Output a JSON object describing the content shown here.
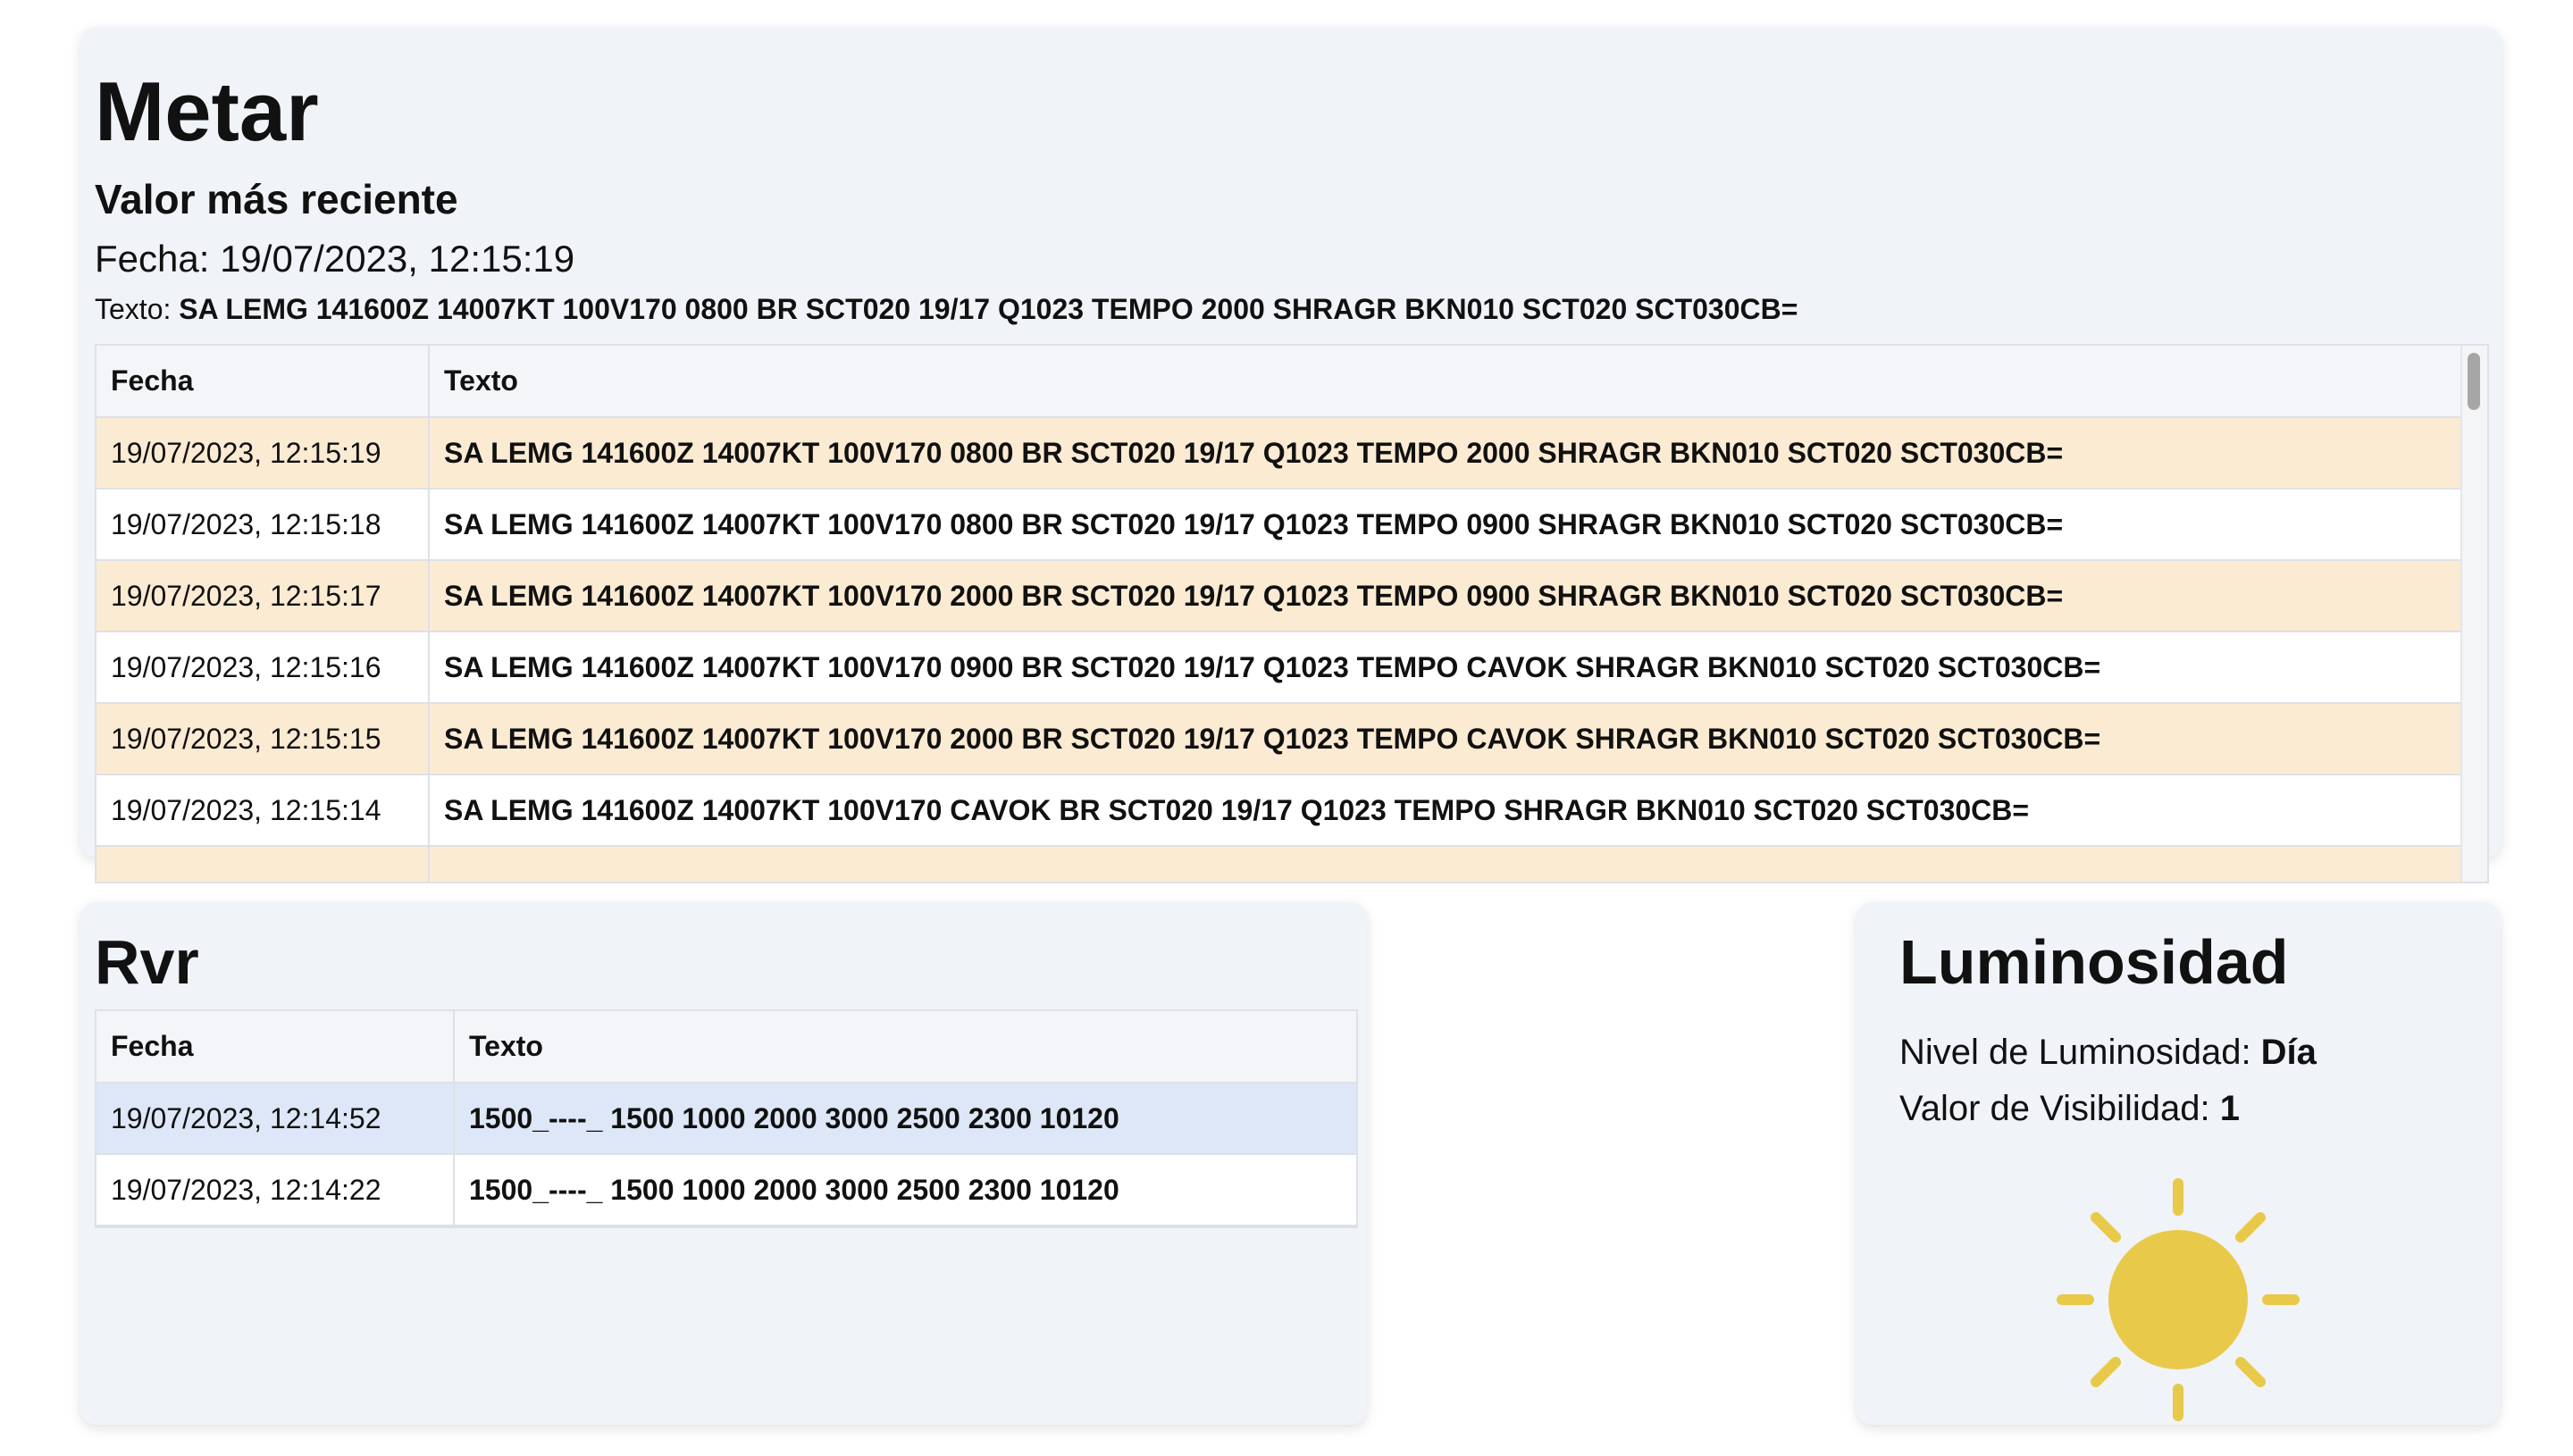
{
  "metar": {
    "title": "Metar",
    "subtitle": "Valor más reciente",
    "fecha_label": "Fecha: ",
    "fecha_value": "19/07/2023, 12:15:19",
    "texto_label": "Texto: ",
    "texto_value": "SA LEMG 141600Z 14007KT 100V170 0800 BR SCT020 19/17 Q1023 TEMPO 2000 SHRAGR BKN010 SCT020 SCT030CB=",
    "columns": [
      "Fecha",
      "Texto"
    ],
    "rows": [
      {
        "fecha": "19/07/2023, 12:15:19",
        "texto": "SA LEMG 141600Z 14007KT 100V170 0800 BR SCT020 19/17 Q1023 TEMPO 2000 SHRAGR BKN010 SCT020 SCT030CB="
      },
      {
        "fecha": "19/07/2023, 12:15:18",
        "texto": "SA LEMG 141600Z 14007KT 100V170 0800 BR SCT020 19/17 Q1023 TEMPO 0900 SHRAGR BKN010 SCT020 SCT030CB="
      },
      {
        "fecha": "19/07/2023, 12:15:17",
        "texto": "SA LEMG 141600Z 14007KT 100V170 2000 BR SCT020 19/17 Q1023 TEMPO 0900 SHRAGR BKN010 SCT020 SCT030CB="
      },
      {
        "fecha": "19/07/2023, 12:15:16",
        "texto": "SA LEMG 141600Z 14007KT 100V170 0900 BR SCT020 19/17 Q1023 TEMPO CAVOK SHRAGR BKN010 SCT020 SCT030CB="
      },
      {
        "fecha": "19/07/2023, 12:15:15",
        "texto": "SA LEMG 141600Z 14007KT 100V170 2000 BR SCT020 19/17 Q1023 TEMPO CAVOK SHRAGR BKN010 SCT020 SCT030CB="
      },
      {
        "fecha": "19/07/2023, 12:15:14",
        "texto": "SA LEMG 141600Z 14007KT 100V170 CAVOK BR SCT020 19/17 Q1023 TEMPO SHRAGR BKN010 SCT020 SCT030CB="
      }
    ]
  },
  "rvr": {
    "title": "Rvr",
    "columns": [
      "Fecha",
      "Texto"
    ],
    "rows": [
      {
        "fecha": "19/07/2023, 12:14:52",
        "texto": "1500_----_ 1500 1000 2000 3000 2500 2300 10120"
      },
      {
        "fecha": "19/07/2023, 12:14:22",
        "texto": "1500_----_ 1500 1000 2000 3000 2500 2300 10120"
      }
    ]
  },
  "luminosidad": {
    "title": "Luminosidad",
    "nivel_label": "Nivel de Luminosidad: ",
    "nivel_value": "Día",
    "visibilidad_label": "Valor de Visibilidad: ",
    "visibilidad_value": "1",
    "icon": "sun-icon"
  },
  "colors": {
    "card_bg": "#f0f3f8",
    "metar_alt_row": "#fcebd3",
    "rvr_selected_row": "#dde7f7",
    "sun": "#e8c94a"
  }
}
